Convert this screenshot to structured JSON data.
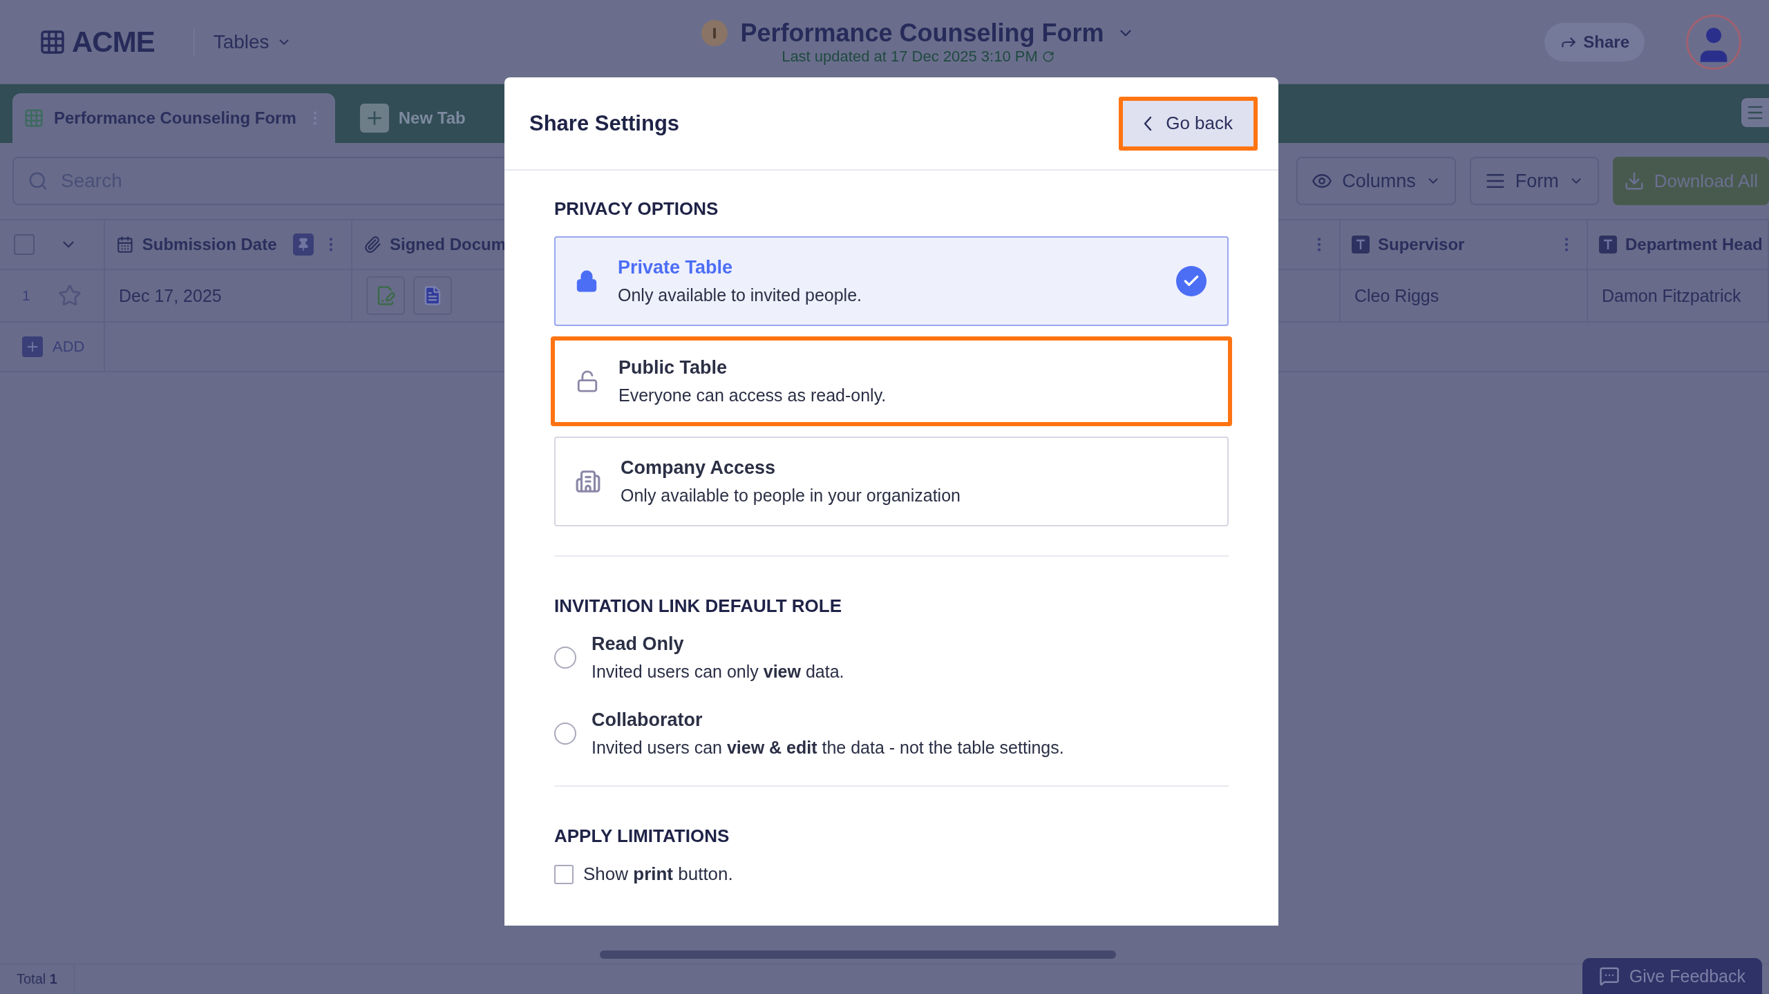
{
  "header": {
    "logo": "ACME",
    "nav": "Tables",
    "form_title": "Performance Counseling Form",
    "updated": "Last updated at 17 Dec 2025 3:10 PM",
    "share": "Share"
  },
  "tabs": [
    {
      "label": "Performance Counseling Form",
      "selected": true
    },
    {
      "label": "New Tab",
      "selected": false
    }
  ],
  "search": {
    "placeholder": "Search"
  },
  "toolbar": [
    {
      "kind": "columns",
      "label": "Columns"
    },
    {
      "kind": "form",
      "label": "Form"
    },
    {
      "kind": "download",
      "label": "Download All"
    }
  ],
  "table": {
    "select_all": {
      "checked": false
    },
    "columns": [
      {
        "kind": "date",
        "label": "Submission Date",
        "pinned": true
      },
      {
        "kind": "file",
        "label": "Signed Docum"
      },
      {
        "kind": "hidden"
      },
      {
        "kind": "text",
        "label": "Supervisor"
      },
      {
        "kind": "text",
        "label": "Department Head"
      }
    ],
    "rows": [
      {
        "number": "1",
        "starred": false,
        "cells": [
          {
            "kind": "text",
            "value": "Dec 17, 2025"
          },
          {
            "kind": "files"
          },
          {
            "kind": "hidden"
          },
          {
            "kind": "text",
            "value": "Cleo Riggs"
          },
          {
            "kind": "text",
            "value": "Damon Fitzpatrick"
          }
        ]
      }
    ],
    "add": "ADD"
  },
  "status_bar": {
    "total": "Total **1**",
    "feedback": "Give Feedback"
  },
  "modal": {
    "title": "Share Settings",
    "back": "Go back",
    "back_highlighted": true,
    "privacy_title": "PRIVACY OPTIONS",
    "privacy_options": [
      {
        "kind": "private",
        "title": "Private Table",
        "description": "Only available to invited people.",
        "selected": true,
        "highlighted": false
      },
      {
        "kind": "public",
        "title": "Public Table",
        "description": "Everyone can access as read-only.",
        "selected": false,
        "highlighted": true
      },
      {
        "kind": "company",
        "title": "Company Access",
        "description": "Only available to people in your organization",
        "selected": false,
        "highlighted": false
      }
    ],
    "roles_title": "INVITATION LINK DEFAULT ROLE",
    "roles": [
      {
        "title": "Read Only",
        "description": "Invited users can only **view** data.",
        "selected": false
      },
      {
        "title": "Collaborator",
        "description": "Invited users can **view & edit** the data - not the table settings.",
        "selected": false
      }
    ],
    "limitations_title": "APPLY LIMITATIONS",
    "limitations": [
      {
        "label": "Show **print** button.",
        "checked": false
      }
    ]
  }
}
